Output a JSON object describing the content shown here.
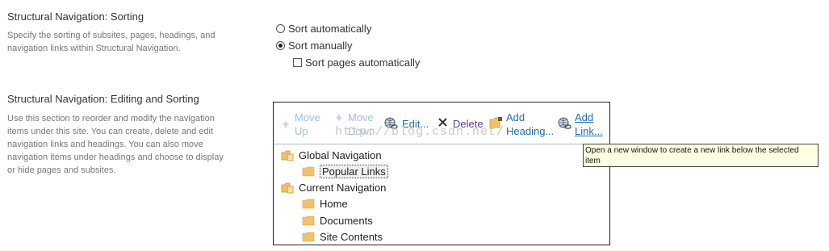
{
  "sorting": {
    "title": "Structural Navigation: Sorting",
    "description_lines": [
      "Specify the sorting of subsites, pages, headings, and",
      "navigation links within Structural Navigation."
    ],
    "options": [
      {
        "label": "Sort automatically",
        "selected": false
      },
      {
        "label": "Sort manually",
        "selected": true
      }
    ],
    "checkbox": {
      "label": "Sort pages automatically",
      "checked": false
    }
  },
  "editing": {
    "title": "Structural Navigation: Editing and Sorting",
    "description_lines": [
      "Use this section to reorder and modify the navigation",
      "items under this site. You can create, delete and edit",
      "navigation links and headings. You can also move",
      "navigation items under headings and choose to display",
      "or hide pages and subsites."
    ]
  },
  "toolbar": {
    "move_up": [
      "Move",
      "Up"
    ],
    "move_down": [
      "Move",
      "Down"
    ],
    "edit": "Edit...",
    "delete": "Delete",
    "add_heading": [
      "Add",
      "Heading..."
    ],
    "add_link": [
      "Add",
      "Link..."
    ]
  },
  "tree": {
    "global": "Global Navigation",
    "popular": "Popular Links",
    "current": "Current Navigation",
    "home": "Home",
    "documents": "Documents",
    "site_contents": "Site Contents"
  },
  "tooltip": {
    "lines": [
      "Open a new window to create a new link below the selected",
      "item"
    ]
  },
  "watermark": "http://blog.csdn.net/",
  "colors": {
    "link": "#1f6fb2",
    "disabled": "#9ec1dc",
    "folder": "#f2c26b",
    "tooltip_bg": "#ffffe1"
  }
}
